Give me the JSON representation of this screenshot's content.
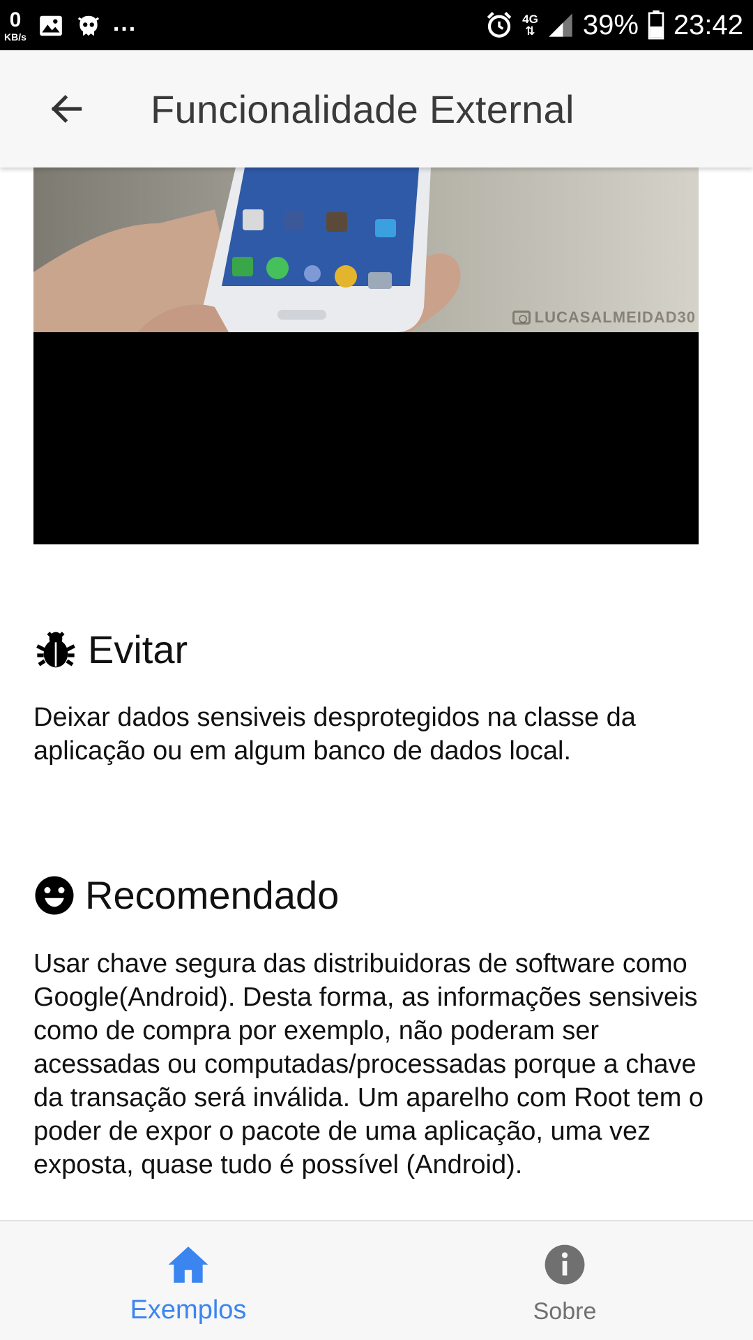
{
  "status_bar": {
    "speed_value": "0",
    "speed_unit": "KB/s",
    "more": "...",
    "network": "4G",
    "battery": "39%",
    "time": "23:42"
  },
  "app_bar": {
    "title": "Funcionalidade External"
  },
  "media": {
    "watermark": "LUCASALMEIDAD30"
  },
  "sections": [
    {
      "icon": "bug-icon",
      "title": "Evitar",
      "body": "Deixar dados sensiveis desprotegidos na classe da aplicação ou em algum banco de dados local."
    },
    {
      "icon": "smile-icon",
      "title": "Recomendado",
      "body": "Usar chave segura das distribuidoras de software como Google(Android). Desta forma, as informações sensiveis como de compra por exemplo, não poderam ser acessadas ou computadas/processadas porque a chave da transação será inválida. Um aparelho com Root tem o poder de expor o pacote de uma aplicação, uma vez exposta, quase tudo é possível (Android)."
    }
  ],
  "bottom_nav": {
    "items": [
      {
        "label": "Exemplos",
        "icon": "home-icon",
        "active": true
      },
      {
        "label": "Sobre",
        "icon": "info-icon",
        "active": false
      }
    ]
  },
  "colors": {
    "accent": "#3a85f0",
    "inactive": "#707070",
    "bar_background": "#f7f7f7"
  }
}
